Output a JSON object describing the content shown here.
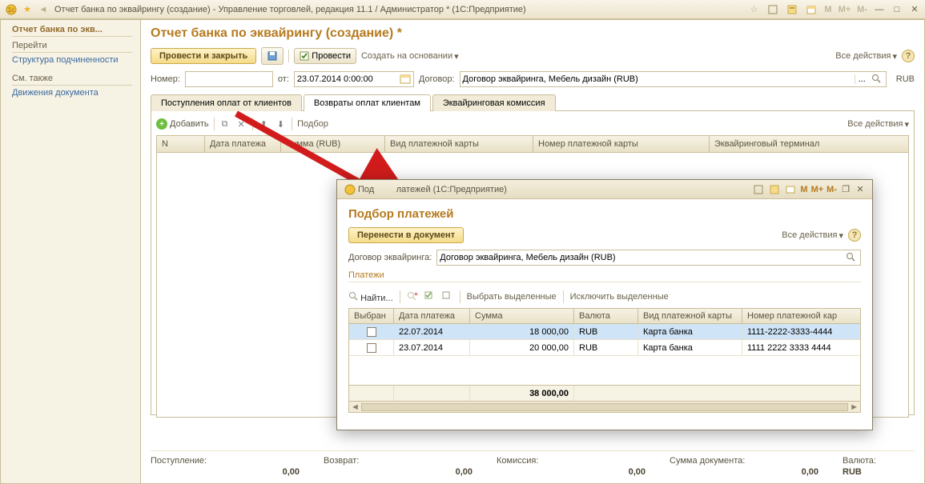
{
  "titlebar": {
    "text": "Отчет банка по эквайрингу (создание) - Управление торговлей, редакция 11.1 / Администратор * (1С:Предприятие)",
    "mcalc": [
      "M",
      "M+",
      "M-"
    ]
  },
  "sidebar": {
    "head": "Отчет банка по экв...",
    "group1": "Перейти",
    "link1": "Структура подчиненности",
    "group2": "См. также",
    "link2": "Движения документа"
  },
  "doc": {
    "title": "Отчет банка по эквайрингу (создание) *",
    "post_close": "Провести и закрыть",
    "post": "Провести",
    "create_on_base": "Создать на основании",
    "all_actions": "Все действия",
    "number_lbl": "Номер:",
    "from_lbl": "от:",
    "date_val": "23.07.2014 0:00:00",
    "contract_lbl": "Договор:",
    "contract_val": "Договор эквайринга, Мебель дизайн (RUB)",
    "currency": "RUB"
  },
  "tabs": {
    "t1": "Поступления оплат от клиентов",
    "t2": "Возвраты оплат клиентам",
    "t3": "Эквайринговая комиссия"
  },
  "grid_tb": {
    "add": "Добавить",
    "podbor": "Подбор",
    "all_actions": "Все действия"
  },
  "grid_cols": {
    "n": "N",
    "date": "Дата платежа",
    "sum": "Сумма (RUB)",
    "card_type": "Вид платежной карты",
    "card_no": "Номер платежной карты",
    "terminal": "Эквайринговый терминал"
  },
  "footer": {
    "in_lbl": "Поступление:",
    "in_val": "0,00",
    "ret_lbl": "Возврат:",
    "ret_val": "0,00",
    "com_lbl": "Комиссия:",
    "com_val": "0,00",
    "doc_lbl": "Сумма документа:",
    "doc_val": "0,00",
    "cur_lbl": "Валюта:",
    "cur_val": "RUB"
  },
  "dialog": {
    "titlebar": "Подбор платежей (1С:Предприятие)",
    "title": "Подбор платежей",
    "transfer": "Перенести в документ",
    "all_actions": "Все действия",
    "contract_lbl": "Договор эквайринга:",
    "contract_val": "Договор эквайринга, Мебель дизайн (RUB)",
    "payments": "Платежи",
    "find": "Найти...",
    "select_checked": "Выбрать выделенные",
    "exclude_checked": "Исключить выделенные",
    "cols": {
      "sel": "Выбран",
      "date": "Дата платежа",
      "sum": "Сумма",
      "cur": "Валюта",
      "ctype": "Вид платежной карты",
      "cno": "Номер платежной кар"
    },
    "rows": [
      {
        "date": "22.07.2014",
        "sum": "18 000,00",
        "cur": "RUB",
        "ctype": "Карта банка",
        "cno": "1111-2222-3333-4444"
      },
      {
        "date": "23.07.2014",
        "sum": "20 000,00",
        "cur": "RUB",
        "ctype": "Карта банка",
        "cno": "1111 2222 3333 4444"
      }
    ],
    "total": "38 000,00",
    "mcalc": [
      "M",
      "M+",
      "M-"
    ]
  }
}
